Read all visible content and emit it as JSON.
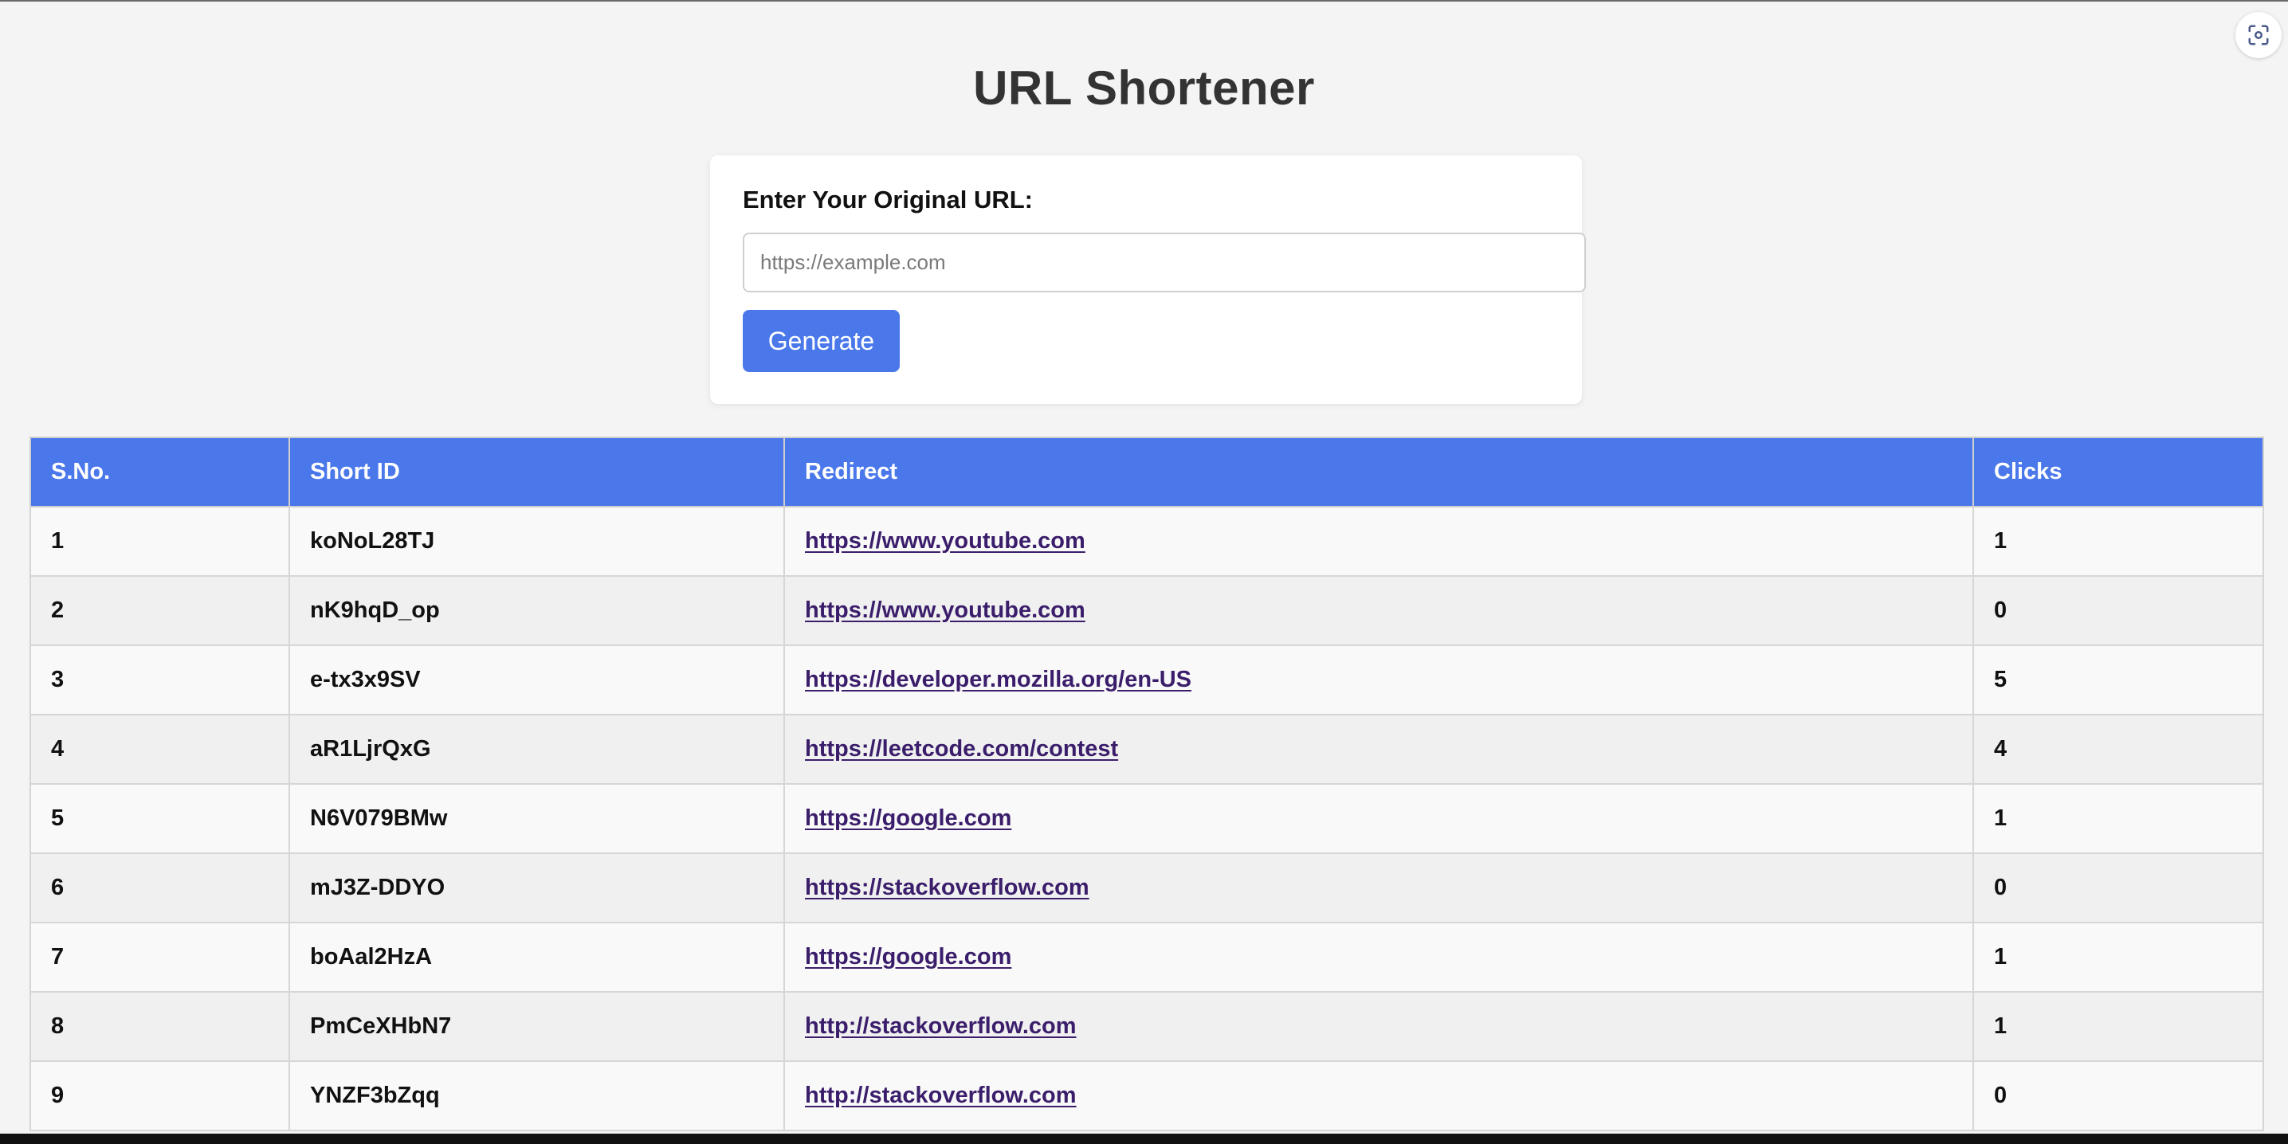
{
  "page": {
    "title": "URL Shortener"
  },
  "form": {
    "label": "Enter Your Original URL:",
    "input_value": "",
    "input_placeholder": "https://example.com",
    "button_label": "Generate"
  },
  "table": {
    "headers": [
      "S.No.",
      "Short ID",
      "Redirect",
      "Clicks"
    ],
    "rows": [
      {
        "sno": "1",
        "short_id": "koNoL28TJ",
        "redirect": "https://www.youtube.com",
        "clicks": "1"
      },
      {
        "sno": "2",
        "short_id": "nK9hqD_op",
        "redirect": "https://www.youtube.com",
        "clicks": "0"
      },
      {
        "sno": "3",
        "short_id": "e-tx3x9SV",
        "redirect": "https://developer.mozilla.org/en-US",
        "clicks": "5"
      },
      {
        "sno": "4",
        "short_id": "aR1LjrQxG",
        "redirect": "https://leetcode.com/contest",
        "clicks": "4"
      },
      {
        "sno": "5",
        "short_id": "N6V079BMw",
        "redirect": "https://google.com",
        "clicks": "1"
      },
      {
        "sno": "6",
        "short_id": "mJ3Z-DDYO",
        "redirect": "https://stackoverflow.com",
        "clicks": "0"
      },
      {
        "sno": "7",
        "short_id": "boAal2HzA",
        "redirect": "https://google.com",
        "clicks": "1"
      },
      {
        "sno": "8",
        "short_id": "PmCeXHbN7",
        "redirect": "http://stackoverflow.com",
        "clicks": "1"
      },
      {
        "sno": "9",
        "short_id": "YNZF3bZqq",
        "redirect": "http://stackoverflow.com",
        "clicks": "0"
      }
    ]
  },
  "overlay": {
    "screenshot_icon": "screen-capture-icon"
  },
  "colors": {
    "accent": "#4a78ea",
    "link": "#3b1e6b",
    "background": "#f4f4f4",
    "title": "#333333"
  }
}
